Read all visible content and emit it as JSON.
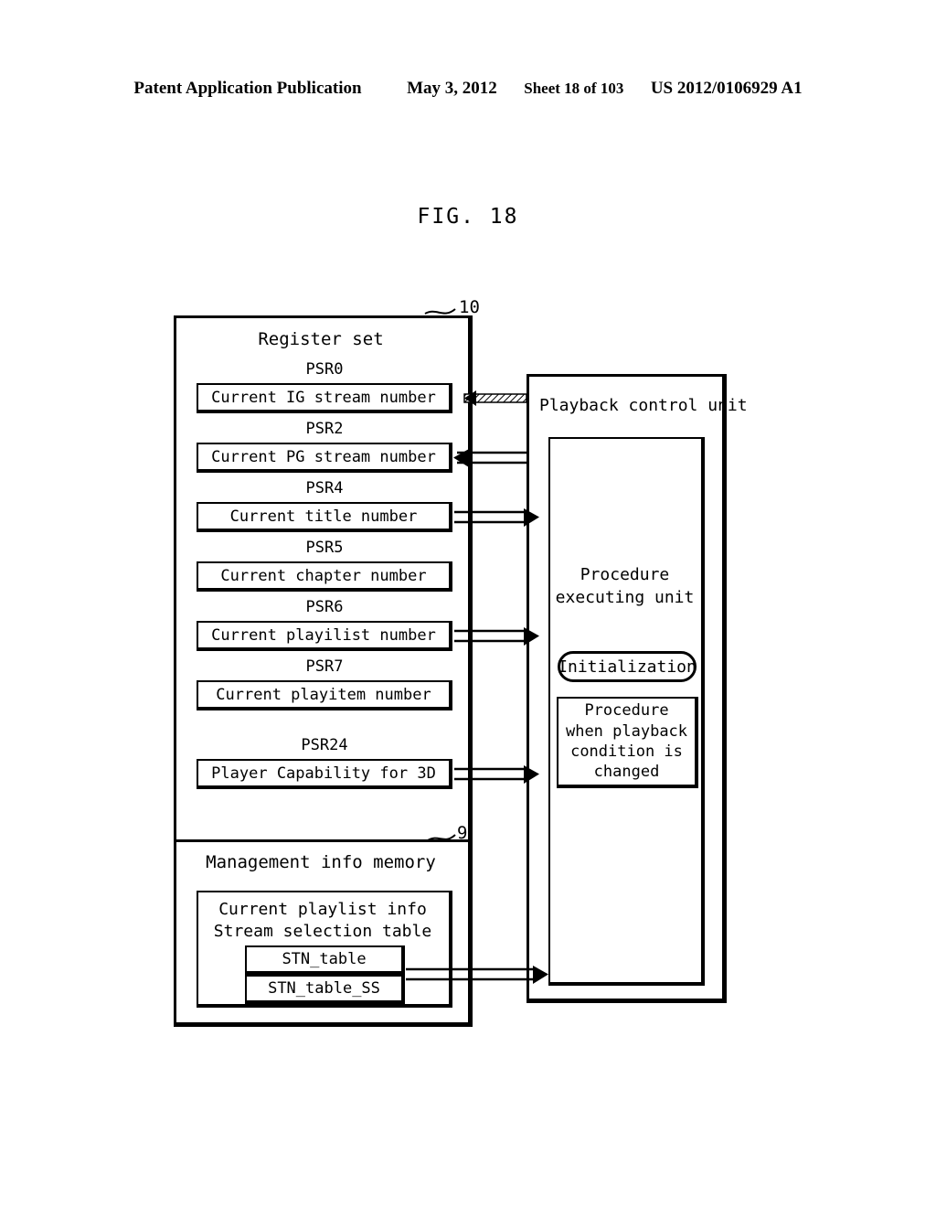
{
  "page_header": {
    "publication": "Patent Application Publication",
    "date": "May 3, 2012",
    "sheet": "Sheet 18 of 103",
    "doc_number": "US 2012/0106929 A1"
  },
  "figure": {
    "title": "FIG. 18"
  },
  "register_set": {
    "title": "Register set",
    "ref_number": "10",
    "registers": [
      {
        "tag": "PSR0",
        "label": "Current IG stream number",
        "flow": "in-hatched"
      },
      {
        "tag": "PSR2",
        "label": "Current PG stream number",
        "flow": "in"
      },
      {
        "tag": "PSR4",
        "label": "Current title number",
        "flow": "out"
      },
      {
        "tag": "PSR5",
        "label": "Current chapter number",
        "flow": "none"
      },
      {
        "tag": "PSR6",
        "label": "Current playilist number",
        "flow": "out"
      },
      {
        "tag": "PSR7",
        "label": "Current playitem number",
        "flow": "none"
      },
      {
        "tag": "PSR24",
        "label": "Player Capability for 3D",
        "flow": "out"
      }
    ]
  },
  "management_info_memory": {
    "title": "Management info memory",
    "ref_number": "9",
    "playlist_info": {
      "line1": "Current playlist info",
      "line2": "Stream selection table",
      "tables": [
        {
          "label": "STN_table"
        },
        {
          "label": "STN_table_SS"
        }
      ]
    }
  },
  "playback_control_unit": {
    "title": "Playback control unit",
    "procedure_executing_unit": {
      "title_line1": "Procedure",
      "title_line2": "executing unit",
      "initialization_label": "Initialization",
      "procedure_box": "Procedure\nwhen playback\ncondition is\nchanged"
    }
  },
  "colors": {
    "ink": "#000000",
    "paper": "#ffffff"
  }
}
